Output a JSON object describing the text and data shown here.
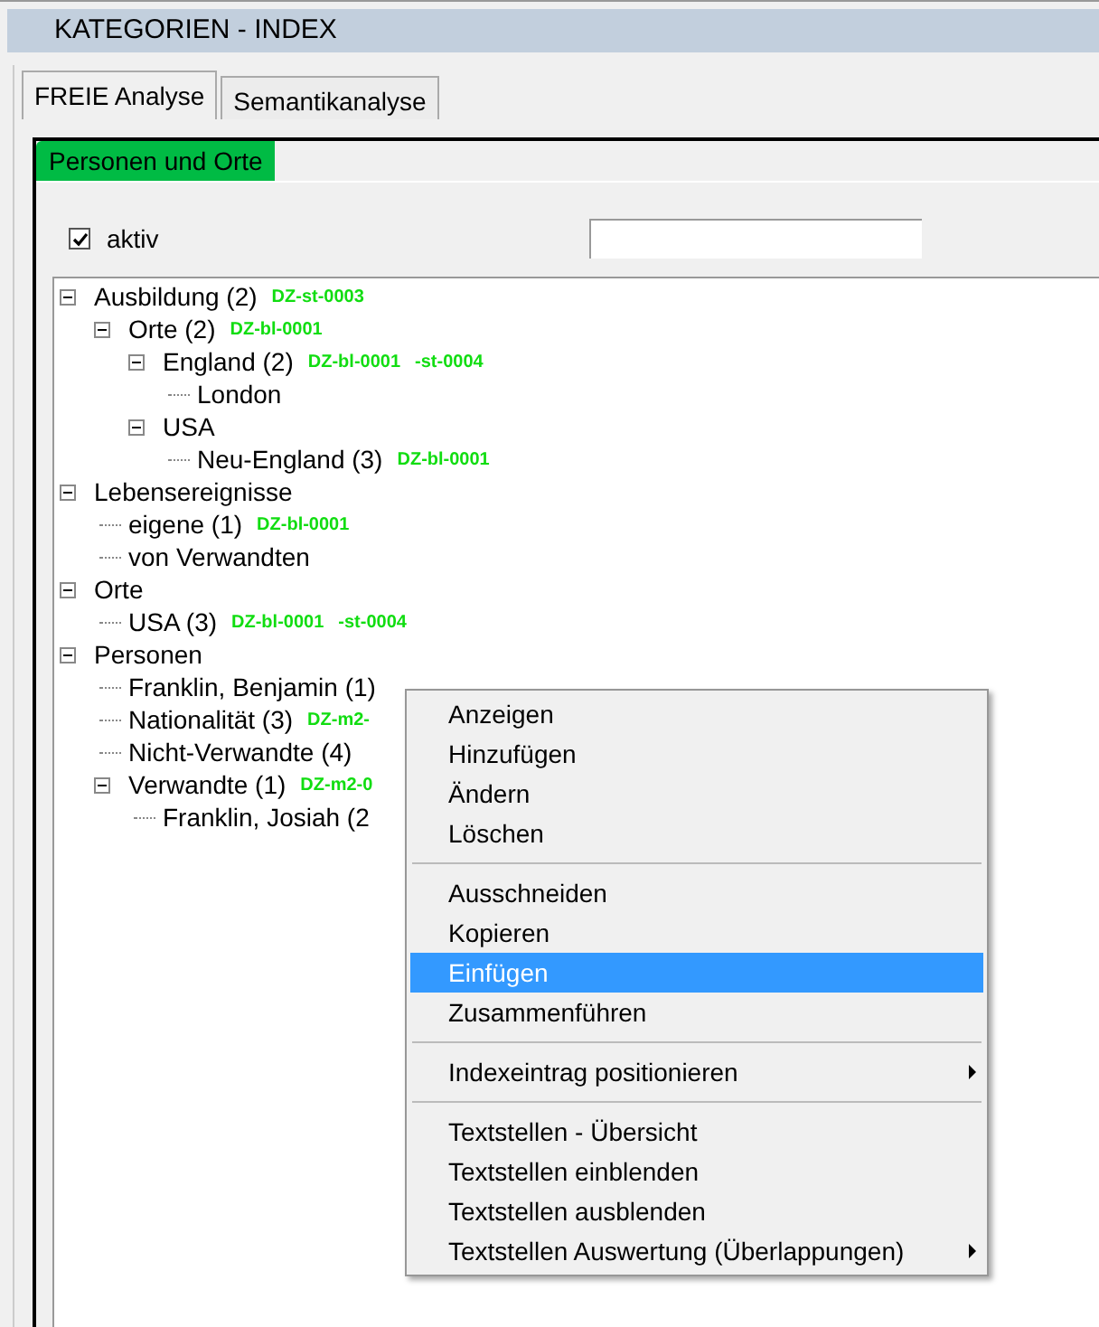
{
  "window": {
    "title": "KATEGORIEN - INDEX"
  },
  "tabs": [
    {
      "label": "FREIE Analyse",
      "selected": true
    },
    {
      "label": "Semantikanalyse",
      "selected": false
    }
  ],
  "subtabs": [
    {
      "label": "Personen und Orte",
      "selected": true
    }
  ],
  "aktiv": {
    "label": "aktiv",
    "checked": true
  },
  "tree": [
    {
      "label": "Ausbildung (2)",
      "codes": [
        "DZ-st-0003"
      ],
      "expanded": true,
      "children": [
        {
          "label": "Orte (2)",
          "codes": [
            "DZ-bl-0001"
          ],
          "expanded": true,
          "children": [
            {
              "label": "England (2)",
              "codes": [
                "DZ-bl-0001",
                "-st-0004"
              ],
              "expanded": true,
              "children": [
                {
                  "label": "London"
                }
              ]
            },
            {
              "label": "USA",
              "expanded": true,
              "children": [
                {
                  "label": "Neu-England (3)",
                  "codes": [
                    "DZ-bl-0001"
                  ]
                }
              ]
            }
          ]
        }
      ]
    },
    {
      "label": "Lebensereignisse",
      "expanded": true,
      "children": [
        {
          "label": "eigene (1)",
          "codes": [
            "DZ-bl-0001"
          ]
        },
        {
          "label": "von Verwandten"
        }
      ]
    },
    {
      "label": "Orte",
      "expanded": true,
      "children": [
        {
          "label": "USA (3)",
          "codes": [
            "DZ-bl-0001",
            "-st-0004"
          ]
        }
      ]
    },
    {
      "label": "Personen",
      "expanded": true,
      "children": [
        {
          "label": "Franklin, Benjamin (1)"
        },
        {
          "label": "Nationalität (3)",
          "codes": [
            "DZ-m2-"
          ]
        },
        {
          "label": "Nicht-Verwandte (4)"
        },
        {
          "label": "Verwandte (1)",
          "codes": [
            "DZ-m2-0"
          ],
          "expanded": true,
          "children": [
            {
              "label": "Franklin, Josiah (2"
            }
          ]
        }
      ]
    }
  ],
  "context_menu": [
    [
      {
        "label": "Anzeigen",
        "selected": false
      },
      {
        "label": "Hinzufügen",
        "selected": false
      },
      {
        "label": "Ändern",
        "selected": false
      },
      {
        "label": "Löschen",
        "selected": false
      }
    ],
    [
      {
        "label": "Ausschneiden",
        "selected": false
      },
      {
        "label": "Kopieren",
        "selected": false
      },
      {
        "label": "Einfügen",
        "selected": true
      },
      {
        "label": "Zusammenführen",
        "selected": false
      }
    ],
    [
      {
        "label": "Indexeintrag positionieren",
        "selected": false,
        "submenu": true
      }
    ],
    [
      {
        "label": "Textstellen - Übersicht",
        "selected": false
      },
      {
        "label": "Textstellen einblenden",
        "selected": false
      },
      {
        "label": "Textstellen ausblenden",
        "selected": false
      },
      {
        "label": "Textstellen Auswertung (Überlappungen)",
        "selected": false,
        "submenu": true
      }
    ]
  ]
}
